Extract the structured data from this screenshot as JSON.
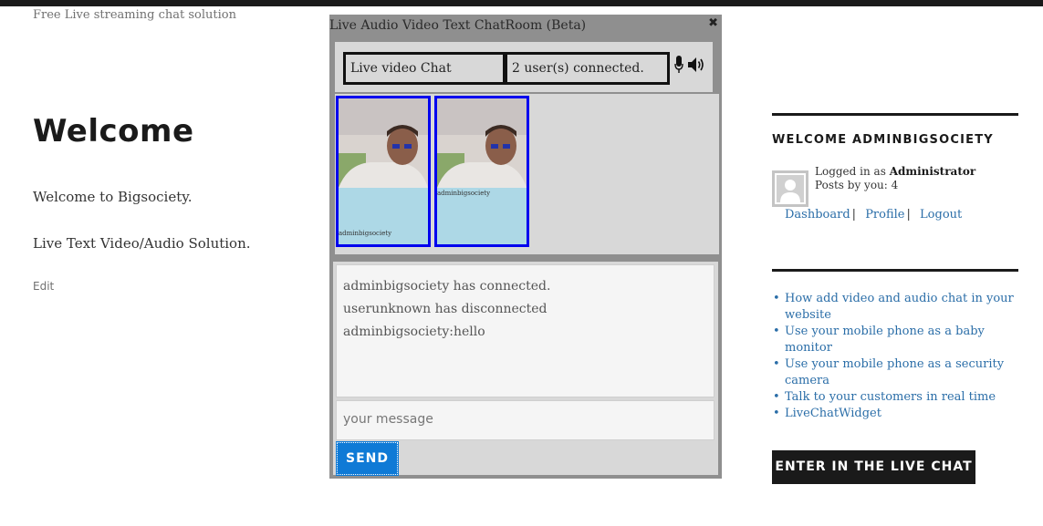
{
  "site": {
    "tagline": "Free Live streaming chat solution"
  },
  "page": {
    "title": "Welcome",
    "paragraphs": [
      "Welcome to Bigsociety.",
      "Live Text Video/Audio Solution."
    ],
    "edit_label": "Edit"
  },
  "chat": {
    "window_title": "Live Audio Video Text ChatRoom (Beta)",
    "close_icon": "✖",
    "room_name": "Live video Chat",
    "users_status": "2 user(s) connected.",
    "video_tiles": [
      {
        "label": "adminbigsociety"
      },
      {
        "label": "adminbigsociety"
      }
    ],
    "messages": [
      "adminbigsociety has connected.",
      "userunknown has disconnected",
      "adminbigsociety:hello"
    ],
    "input_placeholder": "your message",
    "send_label": "SEND",
    "colors": {
      "tile_border": "#0000ee",
      "tile_bg": "#add8e6",
      "send_bg": "#0f7ad6"
    }
  },
  "sidebar": {
    "widget_title": "WELCOME ADMINBIGSOCIETY",
    "logged_prefix": "Logged in as",
    "user_role": "Administrator",
    "posts_count": "Posts by you: 4",
    "links": [
      "Dashboard",
      "Profile",
      "Logout"
    ],
    "recent_posts": [
      "How add video and audio chat in your website",
      "Use your mobile phone as a baby monitor",
      "Use your mobile phone as a security camera",
      "Talk to your customers in real time",
      "LiveChatWidget"
    ],
    "cta_label": "ENTER IN THE LIVE CHAT"
  }
}
